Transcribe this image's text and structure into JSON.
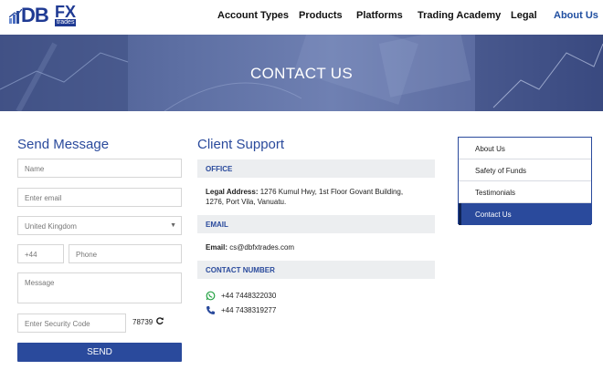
{
  "header": {
    "logo_text_db": "DB",
    "logo_text_fx": "FX",
    "logo_text_trades": "trades",
    "nav": [
      {
        "label": "Account Types"
      },
      {
        "label": "Products"
      },
      {
        "label": "Platforms"
      },
      {
        "label": "Trading Academy"
      },
      {
        "label": "Legal"
      },
      {
        "label": "About Us",
        "active": true
      }
    ]
  },
  "banner": {
    "title": "CONTACT US"
  },
  "send_message": {
    "heading": "Send Message",
    "name_placeholder": "Name",
    "email_placeholder": "Enter email",
    "country_value": "United Kingdom",
    "phone_code": "+44",
    "phone_placeholder": "Phone",
    "message_placeholder": "Message",
    "security_placeholder": "Enter Security Code",
    "security_code": "78739",
    "send_label": "SEND"
  },
  "client_support": {
    "heading": "Client Support",
    "office_heading": "OFFICE",
    "legal_address_label": "Legal Address:",
    "legal_address_line1": "1276 Kumul Hwy, 1st Floor Govant Building,",
    "legal_address_line2": "1276, Port Vila, Vanuatu.",
    "email_heading": "EMAIL",
    "email_label": "Email:",
    "email_value": "cs@dbfxtrades.com",
    "contact_heading": "CONTACT NUMBER",
    "whatsapp_number": "+44 7448322030",
    "phone_number": "+44 7438319277"
  },
  "side_menu": {
    "items": [
      {
        "label": "About Us"
      },
      {
        "label": "Safety of Funds"
      },
      {
        "label": "Testimonials"
      },
      {
        "label": "Contact Us",
        "active": true
      }
    ]
  },
  "colors": {
    "brand_blue": "#2a4a9c",
    "whatsapp_green": "#25a244"
  }
}
